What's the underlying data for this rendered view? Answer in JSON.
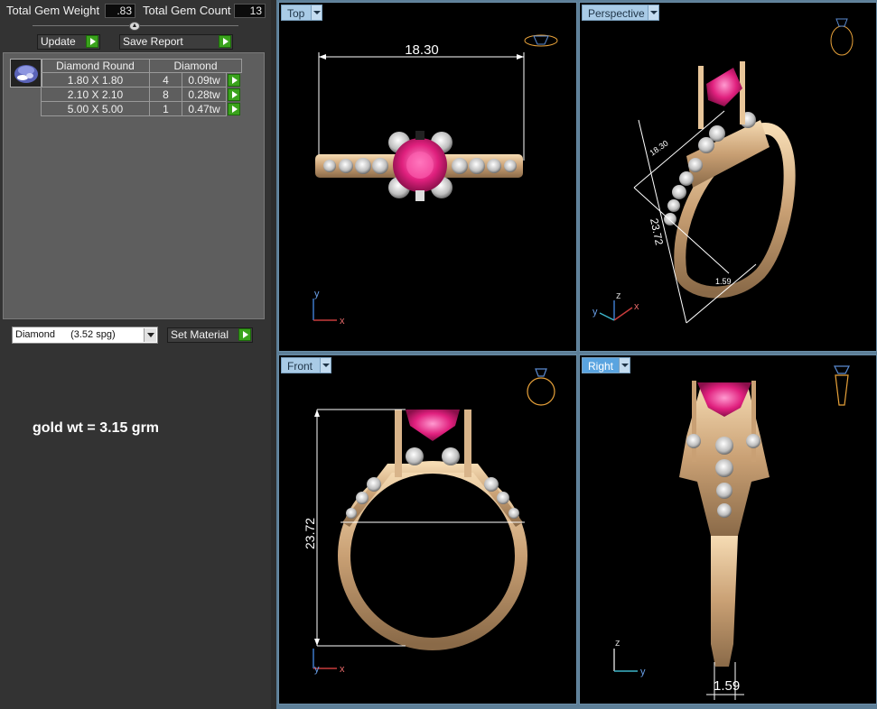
{
  "stats": {
    "total_weight_label": "Total Gem Weight",
    "total_weight_value": ".83",
    "total_count_label": "Total Gem Count",
    "total_count_value": "13"
  },
  "buttons": {
    "update_label": "Update",
    "save_report_label": "Save Report",
    "set_material_label": "Set Material"
  },
  "stone_table": {
    "headers": [
      "Diamond Round",
      "Diamond"
    ],
    "rows": [
      {
        "size": "1.80 X 1.80",
        "count": "4",
        "weight": "0.09tw"
      },
      {
        "size": "2.10 X 2.10",
        "count": "8",
        "weight": "0.28tw"
      },
      {
        "size": "5.00 X 5.00",
        "count": "1",
        "weight": "0.47tw"
      }
    ]
  },
  "material": {
    "name": "Diamond",
    "sg": "(3.52 spg)"
  },
  "note": "gold wt = 3.15 grm",
  "viewports": {
    "top": {
      "label": "Top",
      "dimension": "18.30"
    },
    "perspective": {
      "label": "Perspective",
      "dimension_a": "18.30",
      "dimension_b": "23.72",
      "dimension_c": "1.59"
    },
    "front": {
      "label": "Front",
      "dimension": "23.72"
    },
    "right": {
      "label": "Right",
      "dimension": "1.59"
    }
  },
  "axes": {
    "x": "x",
    "y": "y",
    "z": "z"
  },
  "colors": {
    "gold": "#e8c69a",
    "ruby": "#e0207e",
    "diamond": "#e6e6e6",
    "viewport_bg": "#000000",
    "label_active": "#5aa4e0",
    "go_button": "#3aa21c"
  }
}
